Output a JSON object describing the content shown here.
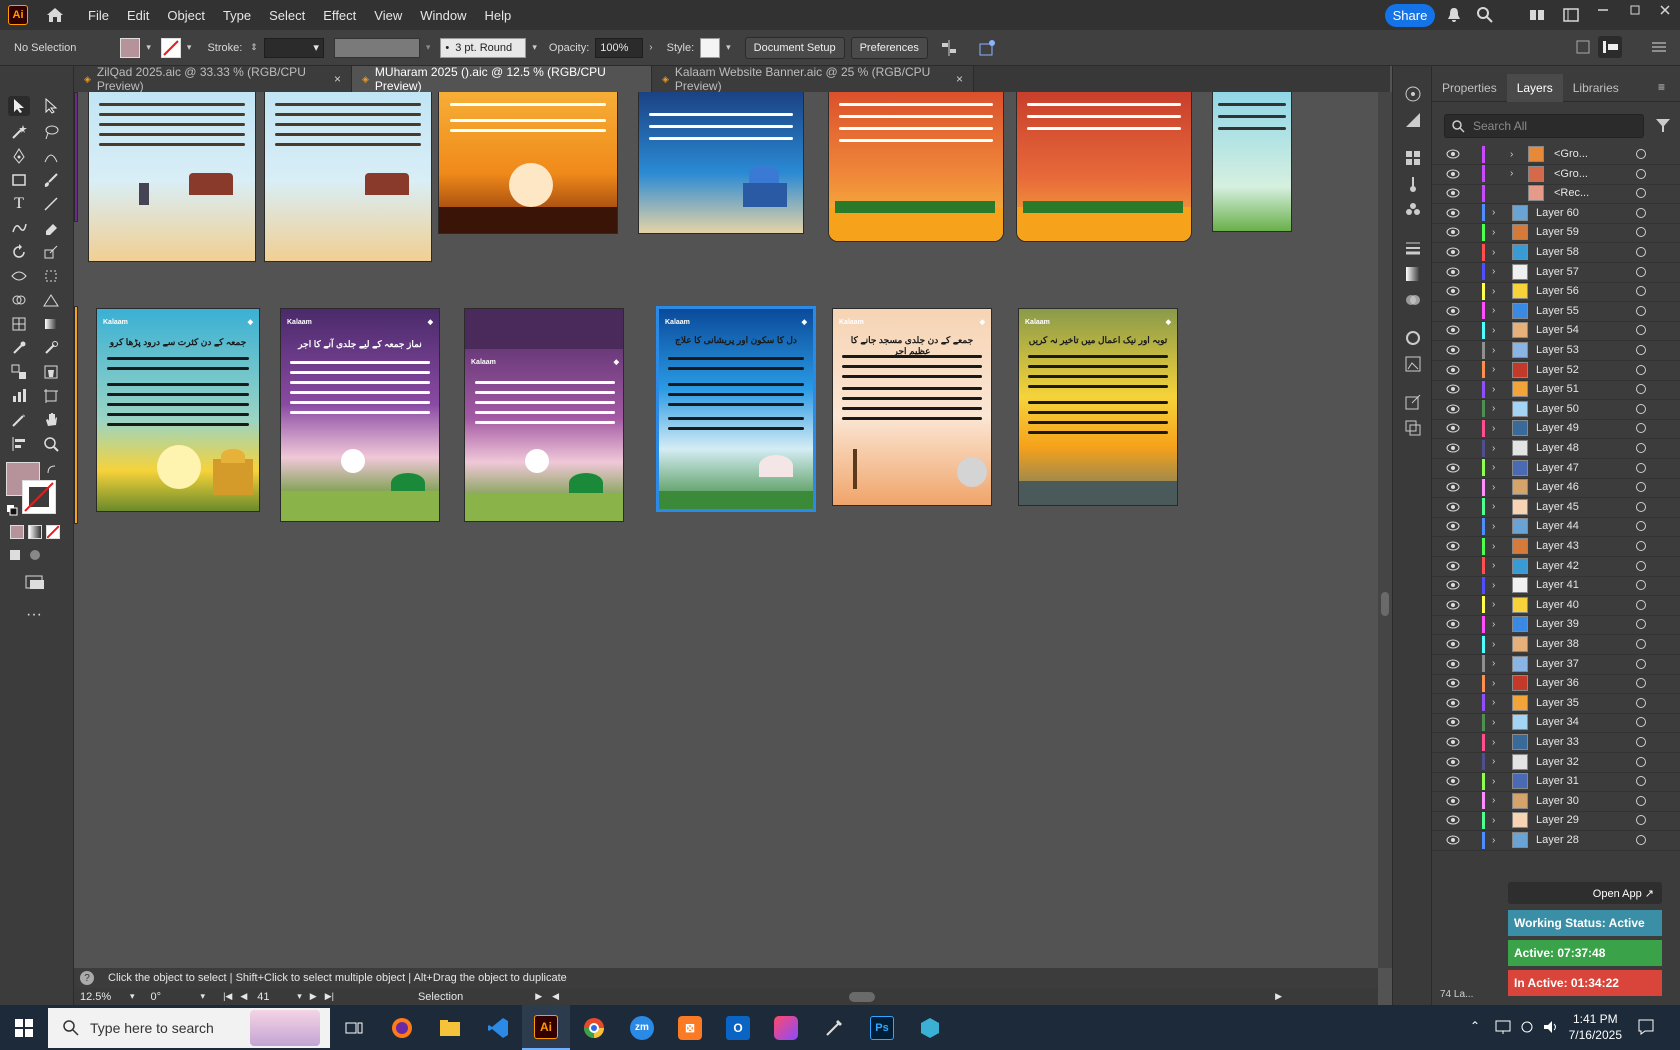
{
  "menu": {
    "items": [
      "File",
      "Edit",
      "Object",
      "Type",
      "Select",
      "Effect",
      "View",
      "Window",
      "Help"
    ],
    "share_label": "Share"
  },
  "control": {
    "selection": "No Selection",
    "stroke_label": "Stroke:",
    "brush": "3 pt. Round",
    "opacity_label": "Opacity:",
    "opacity_value": "100%",
    "style_label": "Style:",
    "doc_setup": "Document Setup",
    "preferences": "Preferences"
  },
  "tabs": [
    {
      "label": "ZilQad 2025.aic @ 33.33 % (RGB/CPU Preview)"
    },
    {
      "label": "MUharam 2025 ().aic @ 12.5 % (RGB/CPU Preview)"
    },
    {
      "label": "Kalaam Website Banner.aic @ 25 % (RGB/CPU Preview)"
    }
  ],
  "tab_close": "×",
  "artboards": {
    "brand": "Kalaam",
    "row2_titles": [
      "جمعہ کے دن کثرت سے درود پڑھا کرو",
      "نماز جمعہ کے لیے جلدی آنے کا اجر",
      "",
      "دل کا سکون اور پریشانی کا علاج",
      "جمعے کے دن جلدی مسجد جانے کا عظیم اجر",
      "توبہ اور نیک اعمال میں تاخیر نہ کریں"
    ]
  },
  "panel": {
    "tabs": [
      "Properties",
      "Layers",
      "Libraries"
    ],
    "search_placeholder": "Search All",
    "groups": [
      "<Gro...",
      "<Gro...",
      "<Rec..."
    ],
    "layers": [
      "Layer 60",
      "Layer 59",
      "Layer 58",
      "Layer 57",
      "Layer 56",
      "Layer 55",
      "Layer 54",
      "Layer 53",
      "Layer 52",
      "Layer 51",
      "Layer 50",
      "Layer 49",
      "Layer 48",
      "Layer 47",
      "Layer 46",
      "Layer 45",
      "Layer 44",
      "Layer 43",
      "Layer 42",
      "Layer 41",
      "Layer 40",
      "Layer 39",
      "Layer 38",
      "Layer 37",
      "Layer 36",
      "Layer 35",
      "Layer 34",
      "Layer 33",
      "Layer 32",
      "Layer 31",
      "Layer 30",
      "Layer 29",
      "Layer 28"
    ],
    "layer_colors": [
      "#4f8cff",
      "#4fff4f",
      "#ff4f4f",
      "#4f4fff",
      "#ffff4f",
      "#ff4fff",
      "#4fffff",
      "#8f8f8f",
      "#ff8f4f",
      "#8f4fff",
      "#4f8f4f",
      "#ff4f8f",
      "#4f4f8f",
      "#8fff4f",
      "#ff8fff",
      "#4fff8f"
    ],
    "footer": "74 La..."
  },
  "overlay": {
    "open_app": "Open App ↗",
    "status": "Working Status: Active",
    "active": "Active: 07:37:48",
    "inactive": "In Active: 01:34:22"
  },
  "status": {
    "hint": "Click the object to select  |  Shift+Click to select multiple object  |  Alt+Drag the object to duplicate",
    "zoom": "12.5%",
    "angle": "0°",
    "artboard": "41",
    "tool": "Selection"
  },
  "taskbar": {
    "search_placeholder": "Type here to search",
    "time": "1:41 PM",
    "date": "7/16/2025"
  },
  "colors": {
    "accent": "#1473e6",
    "status_active": "#3aa34a",
    "status_inactive": "#d9453a",
    "status_working": "#3a8fa6"
  }
}
